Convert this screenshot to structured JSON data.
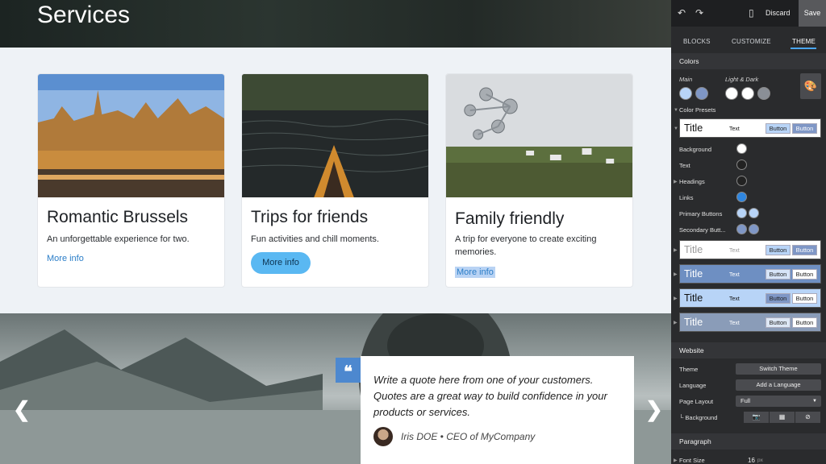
{
  "hero": {
    "title": "Services"
  },
  "cards": [
    {
      "title": "Romantic Brussels",
      "text": "An unforgettable experience for two.",
      "link": "More info"
    },
    {
      "title": "Trips for friends",
      "text": "Fun activities and chill moments.",
      "button": "More info"
    },
    {
      "title": "Family friendly",
      "text": "A trip for everyone to create exciting memories.",
      "link": "More info"
    }
  ],
  "testimonial": {
    "quote": "Write a quote here from one of your customers. Quotes are a great way to build confidence in your products or services.",
    "author": "Iris DOE • CEO of MyCompany",
    "prev_arrow": "❮",
    "next_arrow": "❯",
    "quote_mark": "❝"
  },
  "panel": {
    "topbar": {
      "undo_icon": "↶",
      "redo_icon": "↷",
      "mobile_icon": "▯",
      "discard": "Discard",
      "save": "Save"
    },
    "tabs": [
      "BLOCKS",
      "CUSTOMIZE",
      "THEME"
    ],
    "active_tab": "THEME",
    "colors": {
      "heading": "Colors",
      "main_label": "Main",
      "light_dark_label": "Light & Dark",
      "main_colors": [
        "#b8d4f7",
        "#7f97c6"
      ],
      "light_dark_colors": [
        "#ffffff",
        "#ffffff",
        "#8a8f96"
      ],
      "palette_icon": "🎨",
      "color_presets_label": "Color Presets",
      "rows": [
        {
          "label": "Background",
          "colors": [
            "#ffffff"
          ]
        },
        {
          "label": "Text",
          "colors": [
            "#222222"
          ]
        },
        {
          "label": "Headings",
          "colors": [
            "#222222"
          ]
        },
        {
          "label": "Links",
          "colors": [
            "#2f86e0"
          ]
        },
        {
          "label": "Primary Buttons",
          "colors": [
            "#b8d4f7",
            "#b8d4f7"
          ]
        },
        {
          "label": "Secondary Butt...",
          "colors": [
            "#7f97c6",
            "#7f97c6"
          ]
        }
      ],
      "presets": [
        {
          "title": "Title",
          "text": "Text",
          "button1": "Button",
          "button2": "Button",
          "bg": "#ffffff",
          "fg": "#111111",
          "b1bg": "#b8d4f7",
          "b2bg": "#7f97c6"
        },
        {
          "title": "Title",
          "text": "Text",
          "button1": "Button",
          "button2": "Button",
          "bg": "#ffffff",
          "fg": "#999999",
          "b1bg": "#b8d4f7",
          "b2bg": "#7f97c6"
        },
        {
          "title": "Title",
          "text": "Text",
          "button1": "Button",
          "button2": "Button",
          "bg": "#6e8fc2",
          "fg": "#ffffff",
          "b1bg": "#d6e4f8",
          "b2bg": "#ffffff"
        },
        {
          "title": "Title",
          "text": "Text",
          "button1": "Button",
          "button2": "Button",
          "bg": "#b8d4f7",
          "fg": "#111111",
          "b1bg": "#7f97c6",
          "b2bg": "#ffffff"
        },
        {
          "title": "Title",
          "text": "Text",
          "button1": "Button",
          "button2": "Button",
          "bg": "#8a9cb8",
          "fg": "#ffffff",
          "b1bg": "#dde7f5",
          "b2bg": "#ffffff"
        }
      ]
    },
    "website": {
      "heading": "Website",
      "theme_label": "Theme",
      "theme_button": "Switch Theme",
      "language_label": "Language",
      "language_button": "Add a Language",
      "page_layout_label": "Page Layout",
      "page_layout_value": "Full",
      "background_label": "Background",
      "background_options": [
        "📷",
        "▦",
        "⊘"
      ]
    },
    "paragraph": {
      "heading": "Paragraph",
      "font_size_label": "Font Size",
      "font_size_value": "16",
      "font_size_unit": "px"
    }
  }
}
